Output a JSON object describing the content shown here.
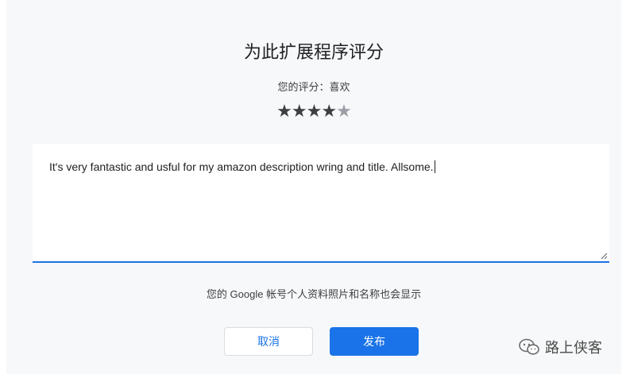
{
  "dialog": {
    "title": "为此扩展程序评分",
    "rating_text": "您的评分：喜欢",
    "rating": {
      "value": 4,
      "max": 5,
      "filled_color": "#3c4043",
      "empty_color": "#9aa0a6"
    },
    "review": {
      "text": "It's very fantastic and usful for my amazon description wring and title. Allsome."
    },
    "notice": "您的 Google 帐号个人资料照片和名称也会显示",
    "buttons": {
      "cancel_label": "取消",
      "publish_label": "发布"
    },
    "accent_color": "#1a73e8"
  },
  "watermark": {
    "icon": "wechat-icon",
    "text": "路上侠客"
  }
}
